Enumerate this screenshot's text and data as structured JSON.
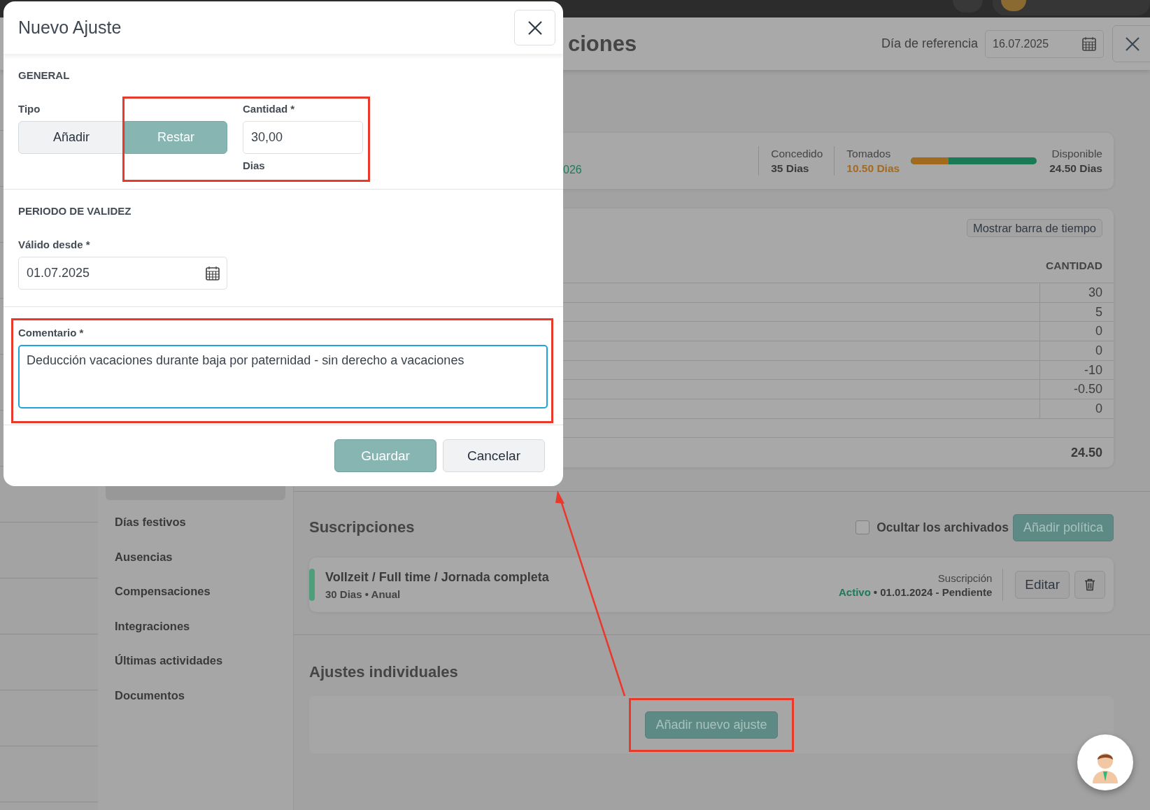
{
  "header": {
    "title": "ciones",
    "reference_label": "Día de referencia",
    "reference_date": "16.07.2025"
  },
  "summary": {
    "period_fragment": "026",
    "stats": [
      {
        "kind": "plain",
        "label": "Concedido",
        "value": "35 Dias"
      },
      {
        "kind": "taken",
        "label": "Tomados",
        "value": "10.50 Dias"
      },
      {
        "kind": "meter",
        "level": 0.3
      },
      {
        "kind": "available",
        "label": "Disponible",
        "value": "24.50 Dias"
      }
    ]
  },
  "ledger": {
    "toggle_button": "Mostrar barra de tiempo",
    "column": "CANTIDAD",
    "rows": [
      "30",
      "5",
      "0",
      "0",
      "-10",
      "-0.50",
      "0"
    ],
    "total": "24.50"
  },
  "sidebar": {
    "items": [
      {
        "selected": true
      },
      {
        "label": "Días festivos",
        "selected": false
      },
      {
        "label": "Ausencias",
        "selected": false
      },
      {
        "label": "Compensaciones",
        "selected": false
      },
      {
        "label": "Integraciones",
        "selected": false
      },
      {
        "label": "Últimas actividades",
        "selected": false
      },
      {
        "label": "Documentos",
        "selected": false
      }
    ]
  },
  "subscriptions": {
    "title": "Suscripciones",
    "hide_archived": {
      "label": "Ocultar los archivados",
      "checked": false
    },
    "add_button": "Añadir política",
    "items": [
      {
        "name": "Vollzeit / Full time / Jornada completa",
        "details": "30 Dias • Anual",
        "type_label": "Suscripción",
        "status": "Activo",
        "period": "• 01.01.2024 - Pendiente",
        "edit_button": "Editar"
      }
    ]
  },
  "individual_adjustments": {
    "title": "Ajustes individuales",
    "add_button": "Añadir nuevo ajuste",
    "annotated": true
  },
  "modal": {
    "title": "Nuevo Ajuste",
    "general": {
      "heading": "GENERAL",
      "type_label": "Tipo",
      "type_options": [
        {
          "label": "Añadir",
          "selected": false
        },
        {
          "label": "Restar",
          "selected": true
        }
      ],
      "amount_label": "Cantidad *",
      "amount_value": "30,00",
      "amount_unit": "Dias",
      "annotated": true
    },
    "validity": {
      "heading": "PERIODO DE VALIDEZ",
      "from_label": "Válido desde *",
      "from_value": "01.07.2025"
    },
    "comment": {
      "label": "Comentario *",
      "value": "Deducción vacaciones durante baja por paternidad - sin derecho a vacaciones",
      "focused": true,
      "annotated": true
    },
    "buttons": [
      {
        "label": "Guardar",
        "kind": "primary"
      },
      {
        "label": "Cancelar",
        "kind": "secondary"
      }
    ]
  }
}
